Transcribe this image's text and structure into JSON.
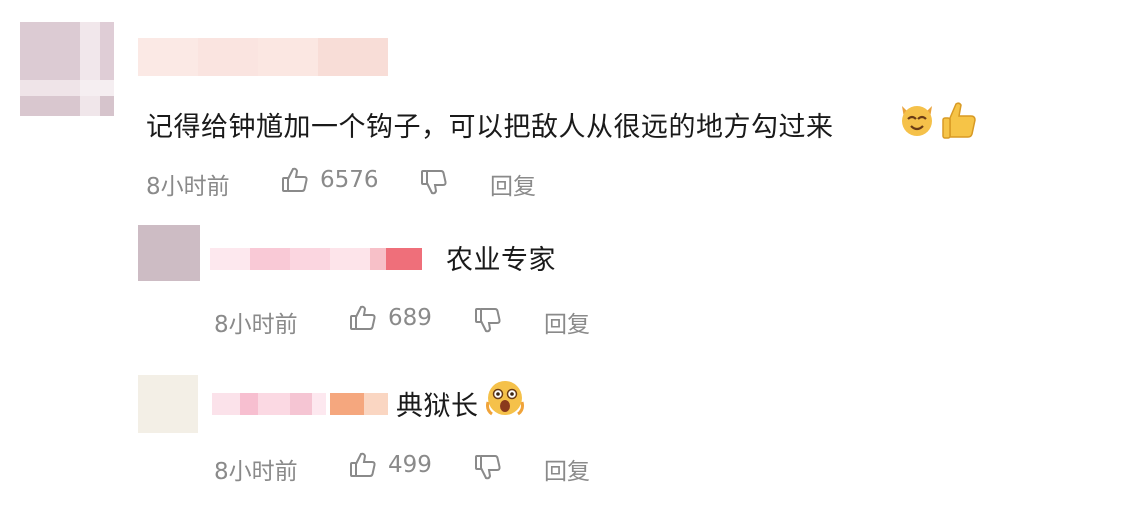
{
  "comment": {
    "text": "记得给钟馗加一个钩子，可以把敌人从很远的地方勾过来",
    "emojis": [
      "cat-face-emoji",
      "thumbs-up-emoji"
    ],
    "time": "8小时前",
    "likes": "6576",
    "reply_label": "回复"
  },
  "replies": [
    {
      "text": "农业专家",
      "time": "8小时前",
      "likes": "689",
      "reply_label": "回复"
    },
    {
      "text": "典狱长",
      "emoji": "fearful-face-emoji",
      "time": "8小时前",
      "likes": "499",
      "reply_label": "回复"
    }
  ],
  "colors": {
    "meta_gray": "#8a8a8a",
    "avatar_pink": "#d8c8cf",
    "name_pink": "#f4b7c8",
    "name_red": "#ef6f7a",
    "name_orange": "#f5a77e"
  }
}
